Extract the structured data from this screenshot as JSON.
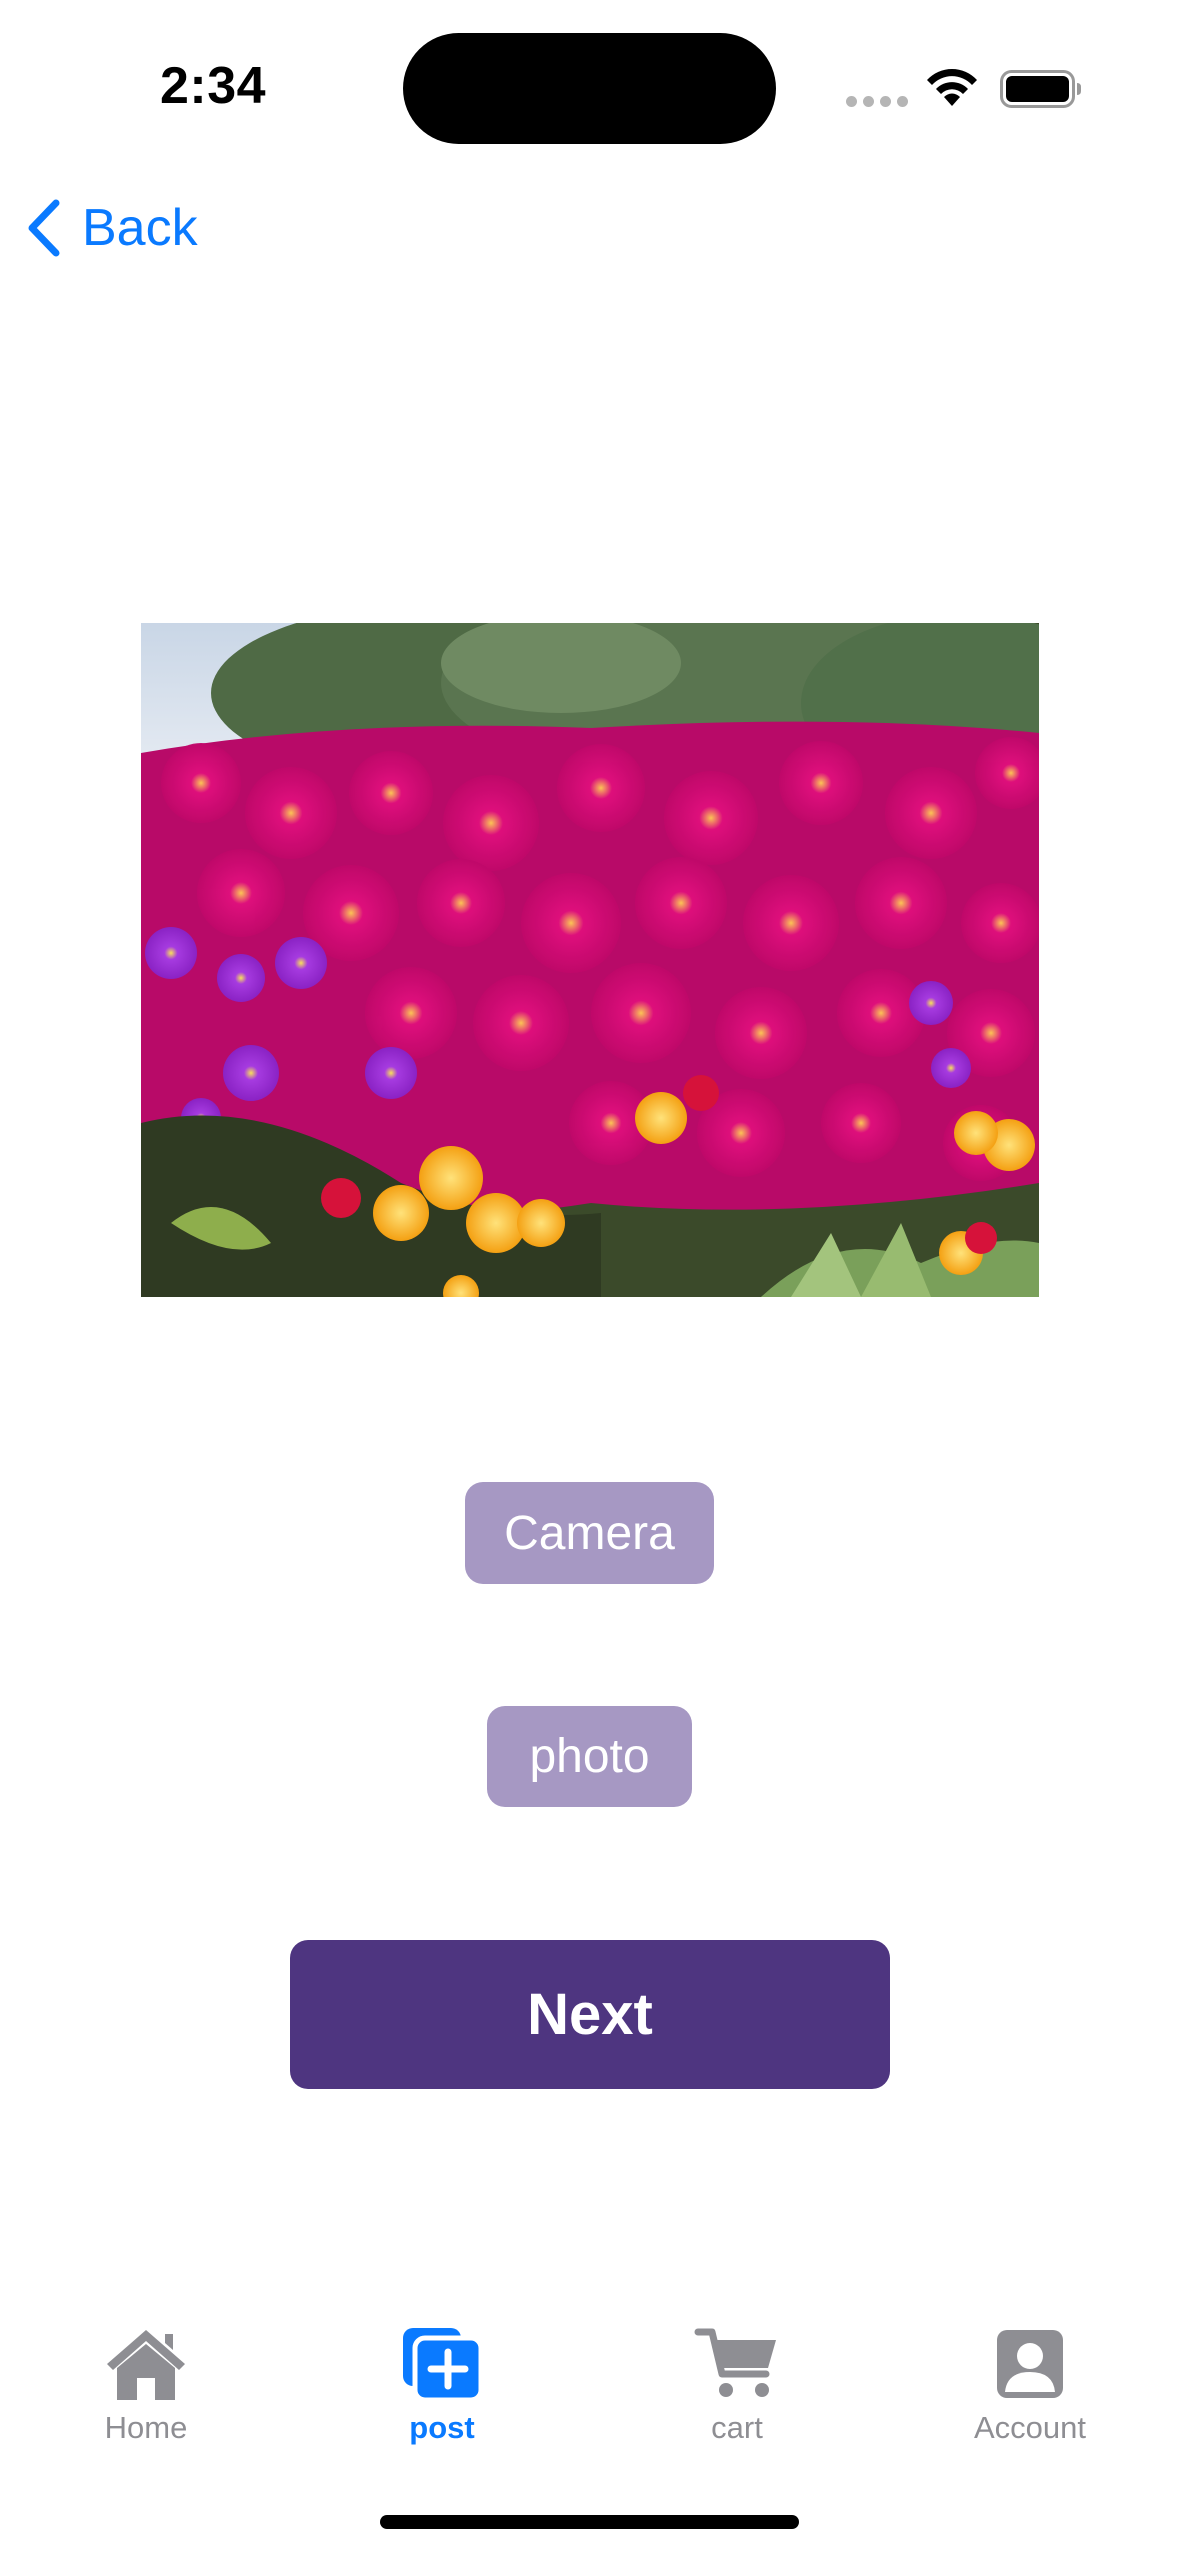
{
  "status_bar": {
    "time": "2:34"
  },
  "nav": {
    "back_label": "Back"
  },
  "image": {
    "description_icon": "flower-photo"
  },
  "buttons": {
    "camera_label": "Camera",
    "photo_label": "photo",
    "next_label": "Next"
  },
  "tabbar": {
    "items": [
      {
        "label": "Home",
        "icon": "house-icon",
        "active": false
      },
      {
        "label": "post",
        "icon": "add-post-icon",
        "active": true
      },
      {
        "label": "cart",
        "icon": "cart-icon",
        "active": false
      },
      {
        "label": "Account",
        "icon": "person-icon",
        "active": false
      }
    ]
  },
  "colors": {
    "accent": "#0a7aff",
    "pill": "#a698c3",
    "primary": "#4e3580",
    "inactive": "#8e8e93"
  }
}
